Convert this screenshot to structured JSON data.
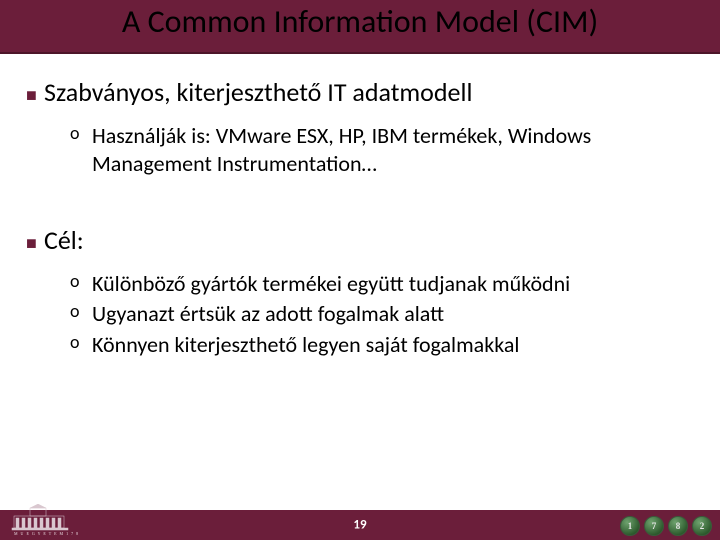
{
  "title": "A Common Information Model (CIM)",
  "bullets": {
    "b1": {
      "text": "Szabványos, kiterjeszthető IT adatmodell",
      "sub": [
        "Használják is: VMware ESX, HP, IBM termékek, Windows Management Instrumentation…"
      ]
    },
    "b2": {
      "text": "Cél:",
      "sub": [
        "Különböző gyártók termékei együtt tudjanak működni",
        "Ugyanazt értsük az adott fogalmak alatt",
        "Könnyen kiterjeszthető legyen saját fogalmakkal"
      ]
    }
  },
  "footer": {
    "page_number": "19",
    "left_logo_label": "university-building-logo",
    "badges": [
      "1",
      "7",
      "8",
      "2"
    ]
  },
  "colors": {
    "brand": "#6b1e3a",
    "badge": "#2f5d2f"
  }
}
